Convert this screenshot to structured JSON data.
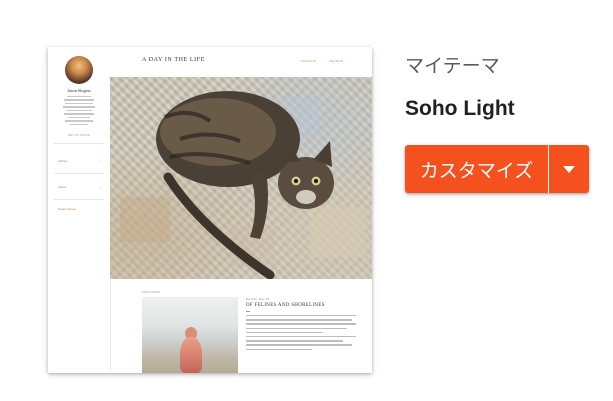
{
  "header": {
    "section_label": "マイテーマ",
    "theme_name": "Soho Light"
  },
  "actions": {
    "customize_label": "カスタマイズ",
    "dropdown_icon": "caret-down-icon"
  },
  "preview": {
    "blog_title": "A DAY IN THE LIFE",
    "nav": [
      "FASHION",
      "SEARCH"
    ],
    "sidebar": {
      "author_name": "Jason Rogers",
      "contact_label": "GET IN TOUCH",
      "nav_items": [
        "Archive",
        "Labels"
      ],
      "recent_label": "Report Abuse"
    },
    "featured_label": "FEATURED",
    "post": {
      "date": "Monday, May 26",
      "title": "OF FELINES AND SHORELINES"
    }
  },
  "colors": {
    "accent": "#f4511e",
    "preview_link": "#d08a5a"
  }
}
